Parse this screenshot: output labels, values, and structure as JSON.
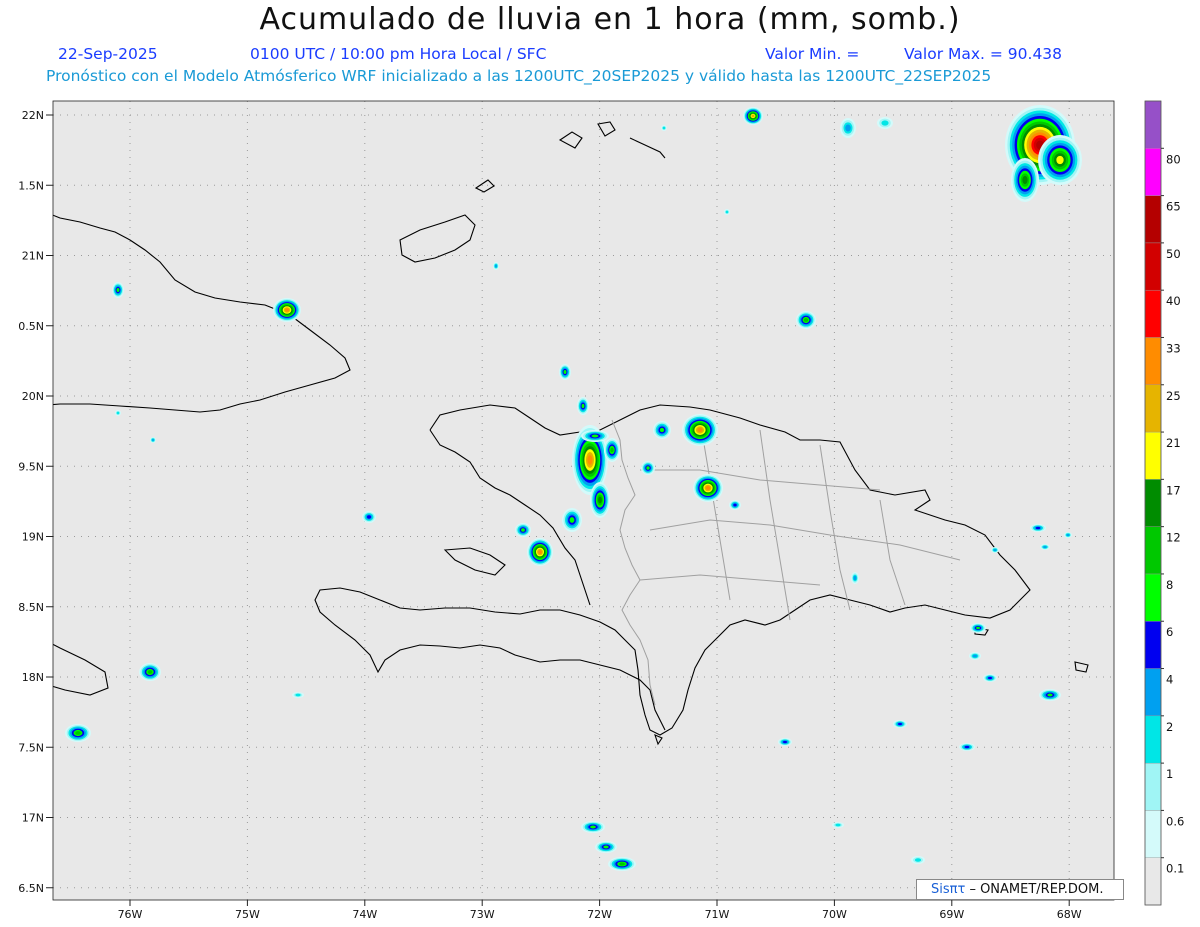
{
  "header": {
    "title": "Acumulado de lluvia en 1 hora (mm, somb.)",
    "date": "22-Sep-2025",
    "time": "0100 UTC / 10:00 pm Hora Local / SFC",
    "min_label": "Valor Min. =",
    "max_label": "Valor Max. = 90.438",
    "model_line": "Pronóstico con el Modelo Atmósferico WRF inicializado a las 1200UTC_20SEP2025 y válido hasta las  1200UTC_22SEP2025"
  },
  "map": {
    "lat_labels": [
      "22N",
      "1.5N",
      "21N",
      "0.5N",
      "20N",
      "9.5N",
      "19N",
      "8.5N",
      "18N",
      "7.5N",
      "17N",
      "6.5N"
    ],
    "lon_labels": [
      "76W",
      "75W",
      "74W",
      "73W",
      "72W",
      "71W",
      "70W",
      "69W",
      "68W"
    ],
    "lat_values": [
      22,
      21.5,
      21,
      20.5,
      20,
      19.5,
      19,
      18.5,
      18,
      17.5,
      17,
      16.5
    ],
    "lon_values": [
      -76,
      -75,
      -74,
      -73,
      -72,
      -71,
      -70,
      -69,
      -68
    ],
    "background": "#e8e8e8",
    "coast_color": "#000000",
    "border_color": "#a0a0a0"
  },
  "colorbar": {
    "levels": [
      "0.1",
      "0.6",
      "1",
      "2",
      "4",
      "6",
      "8",
      "12",
      "17",
      "21",
      "25",
      "33",
      "40",
      "50",
      "65",
      "80"
    ],
    "colors": [
      "#e8e8e8",
      "#d4fafa",
      "#a0f5f5",
      "#00e6e6",
      "#00a0f0",
      "#0000f0",
      "#00ff00",
      "#00c800",
      "#008c00",
      "#ffff00",
      "#e6b400",
      "#ff8c00",
      "#ff0000",
      "#d20000",
      "#b40000",
      "#ff00ff",
      "#9650c8"
    ]
  },
  "credit": {
    "brand": "Sisπτ",
    "org": "– ONAMET/REP.DOM."
  }
}
